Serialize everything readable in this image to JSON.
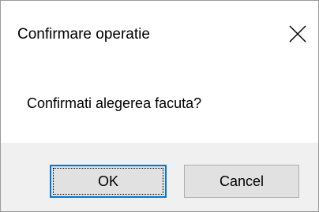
{
  "dialog": {
    "title": "Confirmare operatie",
    "close_icon": "close-icon",
    "message": "Confirmati alegerea facuta?",
    "buttons": {
      "ok_label": "OK",
      "cancel_label": "Cancel"
    },
    "colors": {
      "focus_border": "#0078d7",
      "footer_background": "#f0f0f0",
      "button_background": "#e1e1e1"
    }
  }
}
